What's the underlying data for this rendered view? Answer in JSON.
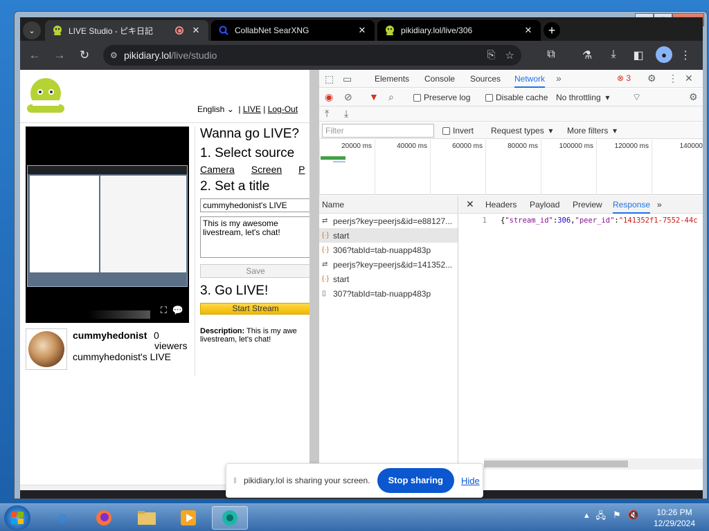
{
  "browser": {
    "tabs": [
      {
        "title": "LIVE Studio - ピキ日記",
        "active": true
      },
      {
        "title": "CollabNet SearXNG",
        "active": false
      },
      {
        "title": "pikidiary.lol/live/306",
        "active": false
      }
    ],
    "url_host": "pikidiary.lol",
    "url_path": "/live/studio"
  },
  "page": {
    "lang": "English",
    "nav_live": "LIVE",
    "nav_logout": "Log-Out",
    "h_wanna": "Wanna go LIVE?",
    "h_select": "1. Select source",
    "src_camera": "Camera",
    "src_screen": "Screen",
    "src_p": "P",
    "h_title": "2. Set a title",
    "title_value": "cummyhedonist's LIVE",
    "desc_value": "This is my awesome livestream, let's chat!",
    "save_label": "Save",
    "h_golive": "3. Go LIVE!",
    "start_label": "Start Stream",
    "desc_label": "Description:",
    "desc_text": " This is my awe",
    "desc_text2": "livestream, let's chat!",
    "username": "cummyhedonist",
    "viewer_count": "0",
    "viewers_label": "viewers",
    "stream_title": "cummyhedonist's LIVE"
  },
  "devtools": {
    "tabs": [
      "Elements",
      "Console",
      "Sources",
      "Network"
    ],
    "error_count": "3",
    "preserve_log": "Preserve log",
    "disable_cache": "Disable cache",
    "throttling": "No throttling",
    "filter_placeholder": "Filter",
    "invert": "Invert",
    "request_types": "Request types",
    "more_filters": "More filters",
    "timeline_ticks": [
      "20000 ms",
      "40000 ms",
      "60000 ms",
      "80000 ms",
      "100000 ms",
      "120000 ms",
      "140000"
    ],
    "name_header": "Name",
    "requests": [
      {
        "name": "peerjs?key=peerjs&id=e88127...",
        "kind": "ws"
      },
      {
        "name": "start",
        "kind": "xhr"
      },
      {
        "name": "306?tabId=tab-nuapp483p",
        "kind": "xhr"
      },
      {
        "name": "peerjs?key=peerjs&id=141352...",
        "kind": "ws"
      },
      {
        "name": "start",
        "kind": "xhr"
      },
      {
        "name": "307?tabId=tab-nuapp483p",
        "kind": "doc"
      }
    ],
    "detail_tabs": [
      "Headers",
      "Payload",
      "Preview",
      "Response"
    ],
    "response_line_no": "1",
    "response_text_k1": "\"stream_id\"",
    "response_text_v1": "306",
    "response_text_k2": "\"peer_id\"",
    "response_text_v2": "\"141352f1-7552-44c"
  },
  "share_banner": {
    "message": "pikidiary.lol is sharing your screen.",
    "stop": "Stop sharing",
    "hide": "Hide"
  },
  "taskbar": {
    "time": "10:26 PM",
    "date": "12/29/2024"
  }
}
